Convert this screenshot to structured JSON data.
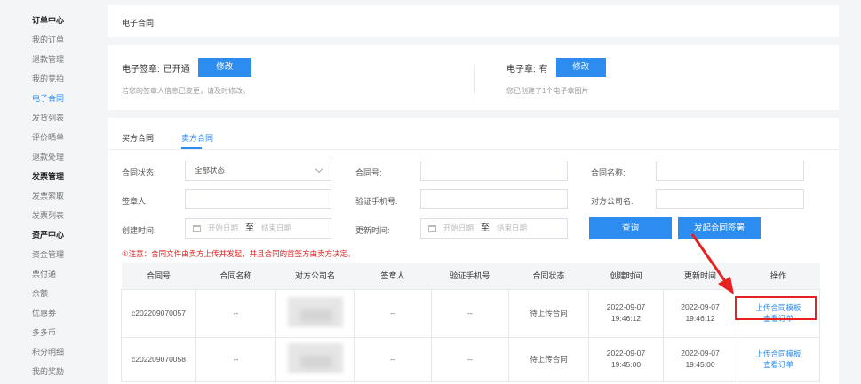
{
  "sidebar": {
    "items": [
      {
        "label": "订单中心",
        "type": "group"
      },
      {
        "label": "我的订单",
        "type": "item"
      },
      {
        "label": "退款管理",
        "type": "item"
      },
      {
        "label": "我的竞拍",
        "type": "item"
      },
      {
        "label": "电子合同",
        "type": "active"
      },
      {
        "label": "发货列表",
        "type": "item"
      },
      {
        "label": "评价晒单",
        "type": "item"
      },
      {
        "label": "退款处理",
        "type": "item"
      },
      {
        "label": "发票管理",
        "type": "group"
      },
      {
        "label": "发票索取",
        "type": "item"
      },
      {
        "label": "发票列表",
        "type": "item"
      },
      {
        "label": "资产中心",
        "type": "group"
      },
      {
        "label": "资金管理",
        "type": "item"
      },
      {
        "label": "票付通",
        "type": "item"
      },
      {
        "label": "余额",
        "type": "item"
      },
      {
        "label": "优惠券",
        "type": "item"
      },
      {
        "label": "多多币",
        "type": "item"
      },
      {
        "label": "积分明细",
        "type": "item"
      },
      {
        "label": "我的奖励",
        "type": "item"
      }
    ]
  },
  "header": {
    "title": "电子合同"
  },
  "signature": {
    "label": "电子签章:",
    "status": "已开通",
    "modify_label": "修改",
    "note": "若您的签章人信息已变更，请及时修改。"
  },
  "seal": {
    "label": "电子章:",
    "status": "有",
    "modify_label": "修改",
    "note": "您已创建了1个电子章图片"
  },
  "tabs": [
    {
      "label": "买方合同",
      "active": false
    },
    {
      "label": "卖方合同",
      "active": true
    }
  ],
  "filters": {
    "contract_status_label": "合同状态:",
    "contract_status_value": "全部状态",
    "contract_no_label": "合同号:",
    "contract_name_label": "合同名称:",
    "signer_label": "签章人:",
    "verify_phone_label": "验证手机号:",
    "counterparty_label": "对方公司名:",
    "created_label": "创建时间:",
    "updated_label": "更新时间:",
    "start_placeholder": "开始日期",
    "end_placeholder": "结束日期",
    "range_sep": "至",
    "query_label": "查询",
    "initiate_label": "发起合同签署"
  },
  "notice": "①注意：合同文件由卖方上传并发起，并且合同的首签方由卖方决定。",
  "table": {
    "headers": [
      "合同号",
      "合同名称",
      "对方公司名",
      "签章人",
      "验证手机号",
      "合同状态",
      "创建时间",
      "更新时间",
      "操作"
    ],
    "rows": [
      {
        "contract_no": "c202209070057",
        "name": "--",
        "signer": "--",
        "phone": "--",
        "status": "待上传合同",
        "created_date": "2022-09-07",
        "created_time": "19:46:12",
        "updated_date": "2022-09-07",
        "updated_time": "19:46:12",
        "action_upload": "上传合同模板",
        "action_view": "查看订单"
      },
      {
        "contract_no": "c202209070058",
        "name": "--",
        "signer": "--",
        "phone": "--",
        "status": "待上传合同",
        "created_date": "2022-09-07",
        "created_time": "19:45:00",
        "updated_date": "2022-09-07",
        "updated_time": "19:45:00",
        "action_upload": "上传合同模板",
        "action_view": "查看订单"
      }
    ]
  },
  "colors": {
    "accent": "#2d8cf0",
    "warning": "#ff8a00",
    "notice": "#e02020",
    "annotation": "#e62121"
  }
}
